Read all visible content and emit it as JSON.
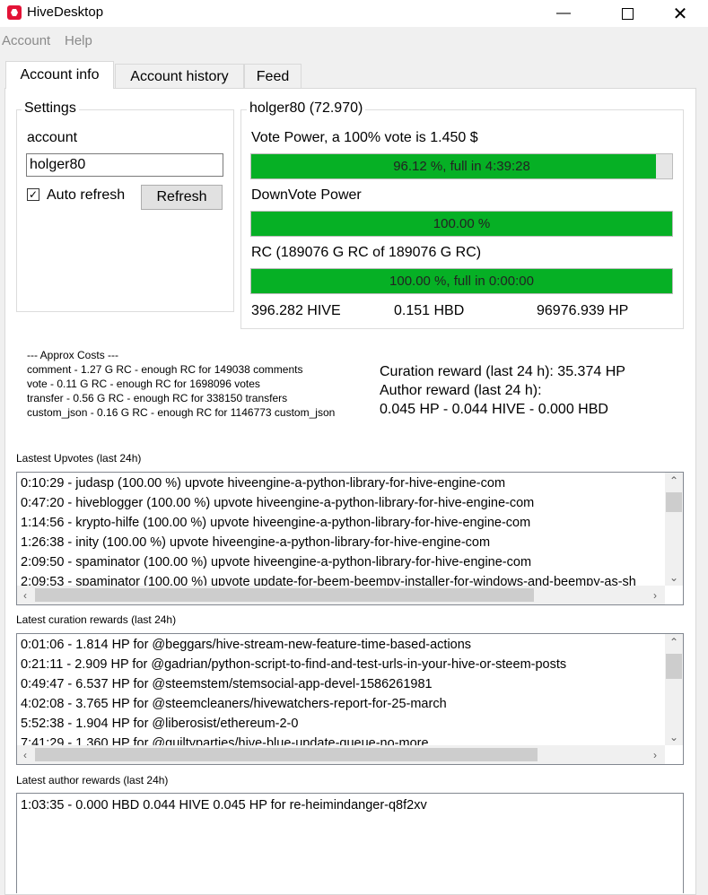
{
  "window": {
    "title": "HiveDesktop"
  },
  "menu": [
    "Account",
    "Help"
  ],
  "tabs": [
    "Account info",
    "Account history",
    "Feed"
  ],
  "settings": {
    "group_title": "Settings",
    "account_label": "account",
    "account_value": "holger80",
    "auto_refresh_label": "Auto refresh",
    "auto_refresh_checked": true,
    "refresh_button": "Refresh"
  },
  "account": {
    "group_title": "holger80 (72.970)",
    "vote_power_label": "Vote Power, a 100% vote is 1.450 $",
    "vote_power_bar": {
      "text": "96.12 %, full in 4:39:28",
      "percent": 96.12
    },
    "downvote_label": "DownVote Power",
    "downvote_bar": {
      "text": "100.00 %",
      "percent": 100
    },
    "rc_label": "RC (189076 G RC of 189076 G RC)",
    "rc_bar": {
      "text": "100.00 %, full in 0:00:00",
      "percent": 100
    },
    "hive": "396.282 HIVE",
    "hbd": "0.151 HBD",
    "hp": "96976.939 HP"
  },
  "costs": {
    "header": "--- Approx Costs ---",
    "lines": [
      "comment - 1.27 G RC - enough RC for 149038 comments",
      "vote - 0.11 G RC - enough RC for 1698096 votes",
      "transfer - 0.56 G RC - enough RC for 338150 transfers",
      "custom_json - 0.16 G RC - enough RC for 1146773 custom_json"
    ]
  },
  "rewards": {
    "curation": "Curation reward (last 24 h): 35.374 HP",
    "author": "Author reward (last 24 h):",
    "author_values": "0.045 HP - 0.044 HIVE - 0.000 HBD"
  },
  "upvotes": {
    "label": "Lastest Upvotes (last 24h)",
    "items": [
      "0:10:29 - judasp (100.00 %) upvote hiveengine-a-python-library-for-hive-engine-com",
      "0:47:20 - hiveblogger (100.00 %) upvote hiveengine-a-python-library-for-hive-engine-com",
      "1:14:56 - krypto-hilfe (100.00 %) upvote hiveengine-a-python-library-for-hive-engine-com",
      "1:26:38 - inity (100.00 %) upvote hiveengine-a-python-library-for-hive-engine-com",
      "2:09:50 - spaminator (100.00 %) upvote hiveengine-a-python-library-for-hive-engine-com",
      "2:09:53 - spaminator (100.00 %) upvote update-for-beem-beempy-installer-for-windows-and-beempy-as-sh"
    ]
  },
  "curation_list": {
    "label": "Latest curation rewards (last 24h)",
    "items": [
      "0:01:06 - 1.814 HP for @beggars/hive-stream-new-feature-time-based-actions",
      "0:21:11 - 2.909 HP for @gadrian/python-script-to-find-and-test-urls-in-your-hive-or-steem-posts",
      "0:49:47 - 6.537 HP for @steemstem/stemsocial-app-devel-1586261981",
      "4:02:08 - 3.765 HP for @steemcleaners/hivewatchers-report-for-25-march",
      "5:52:38 - 1.904 HP for @liberosist/ethereum-2-0",
      "7:41:29 - 1.360 HP for @guiltyparties/hive-blue-update-queue-no-more"
    ]
  },
  "author_list": {
    "label": "Latest author rewards (last 24h)",
    "items": [
      "1:03:35 - 0.000 HBD 0.044 HIVE 0.045 HP for re-heimindanger-q8f2xv"
    ]
  },
  "icons": {
    "app": "hive-logo-icon",
    "minimize": "minimize-icon",
    "maximize": "maximize-icon",
    "close": "close-icon"
  },
  "colors": {
    "progress": "#06b025"
  }
}
